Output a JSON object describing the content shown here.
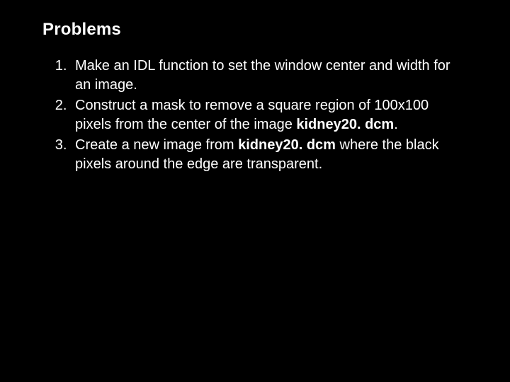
{
  "title": "Problems",
  "items": {
    "p1": "Make an IDL function to set the window center and width for an image.",
    "p2a": "Construct a mask to remove a square region of 100x100 pixels from the center of the image ",
    "p2b": "kidney20. dcm",
    "p2c": ".",
    "p3a": "Create a new image from ",
    "p3b": "kidney20. dcm",
    "p3c": " where the black pixels around the edge are transparent."
  }
}
